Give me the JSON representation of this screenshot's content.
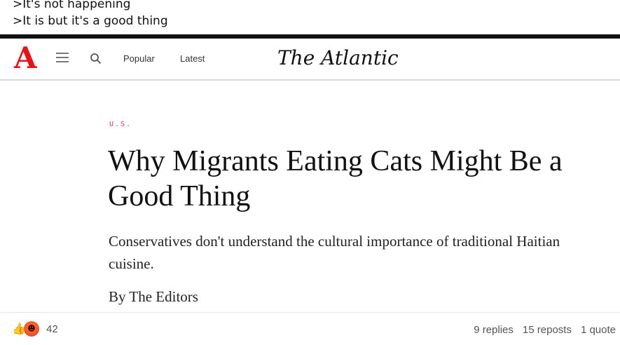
{
  "post": {
    "lines": [
      ">It's not happening",
      ">It is but it's a good thing"
    ]
  },
  "site": {
    "logo_letter": "A",
    "masthead": "The Atlantic",
    "nav": {
      "popular": "Popular",
      "latest": "Latest"
    },
    "accent_color": "#e7131a"
  },
  "article": {
    "section": "U.S.",
    "headline": "Why Migrants Eating Cats Might Be a Good Thing",
    "dek": "Conservatives don't understand the cultural importance of traditional Haitian cuisine.",
    "byline": "By The Editors"
  },
  "engagement": {
    "reaction_icons": [
      "thumbs-up-icon",
      "angry-face-icon"
    ],
    "reaction_count": "42",
    "replies": "9 replies",
    "reposts": "15 reposts",
    "quotes": "1 quote"
  }
}
